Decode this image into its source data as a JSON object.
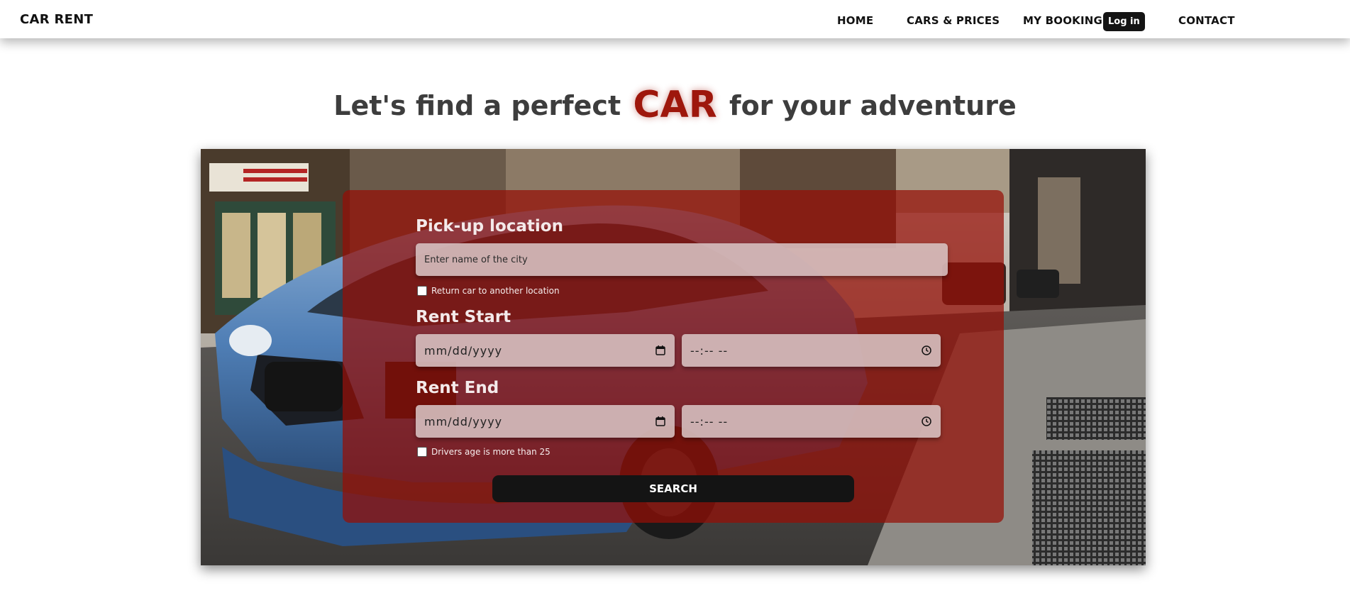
{
  "nav": {
    "brand": "CAR RENT",
    "home": "HOME",
    "cars_prices": "CARS & PRICES",
    "my_booking": "MY BOOKING",
    "login": "Log in",
    "contact": "CONTACT"
  },
  "headline": {
    "before": "Let's find a perfect",
    "highlight": "CAR",
    "after": "for your adventure"
  },
  "form": {
    "pickup_label": "Pick-up location",
    "city_placeholder": "Enter name of the city",
    "return_checkbox": "Return car to another location",
    "rent_start_label": "Rent Start",
    "rent_end_label": "Rent End",
    "date_placeholder": "mm/dd/yyyy",
    "time_placeholder": "--:-- --",
    "age_checkbox": "Drivers age is more than 25",
    "search_button": "SEARCH"
  },
  "colors": {
    "accent": "#9e170c",
    "panel": "#960e06",
    "dark": "#141414"
  },
  "icons": {
    "date": "calendar-icon",
    "time": "clock-icon"
  }
}
